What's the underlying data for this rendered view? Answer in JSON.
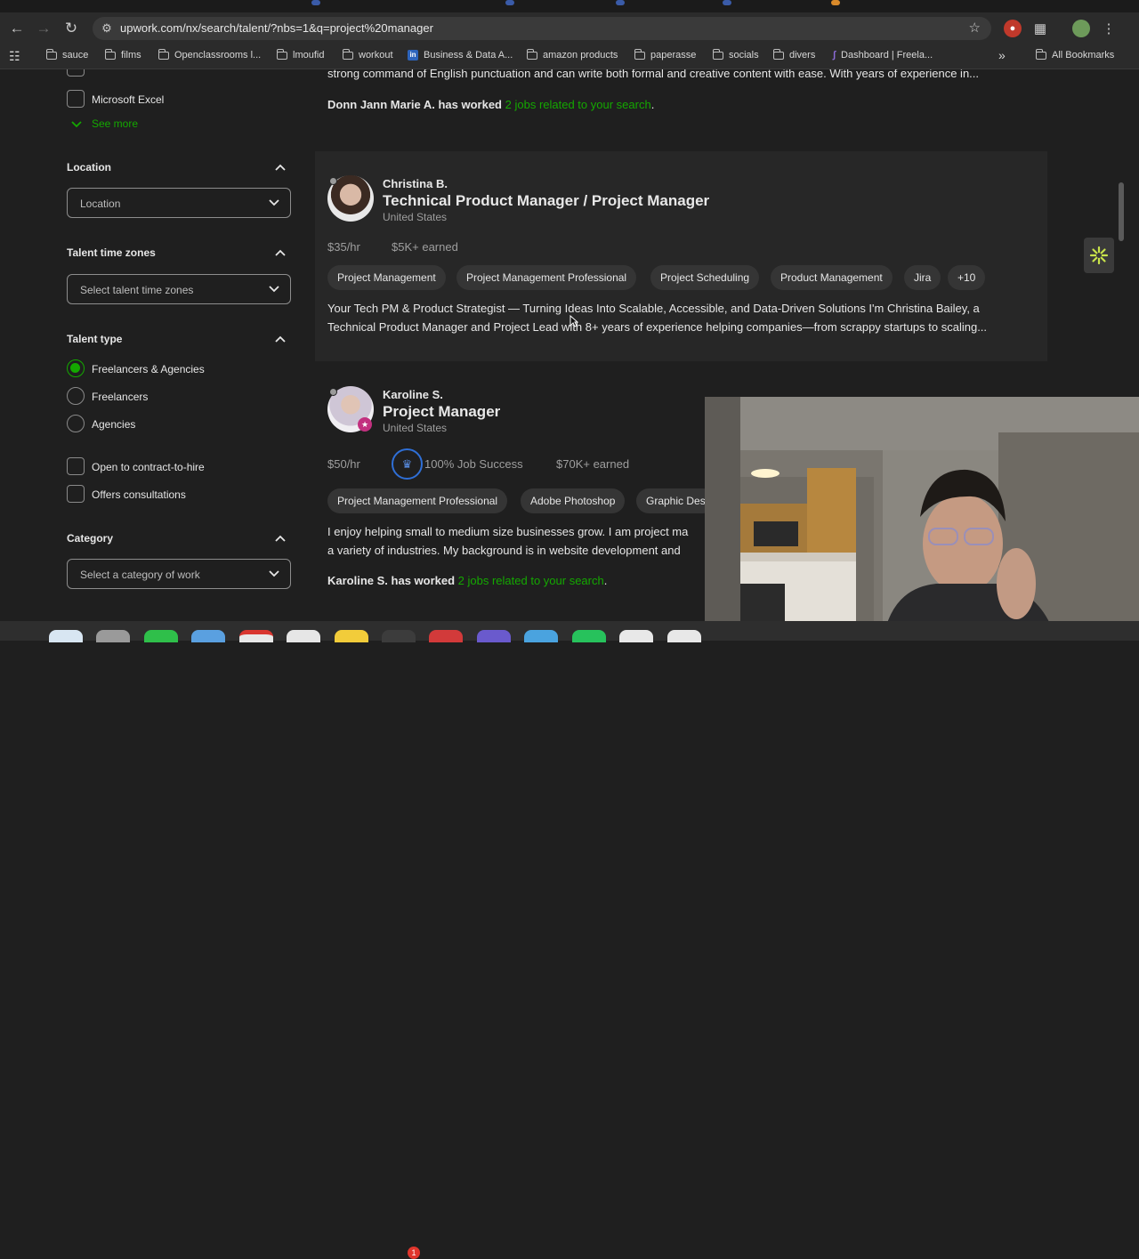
{
  "browser": {
    "url": "upwork.com/nx/search/talent/?nbs=1&q=project%20manager",
    "bookmarks": [
      "sauce",
      "films",
      "Openclassrooms l...",
      "lmoufid",
      "workout",
      "Business & Data A...",
      "amazon products",
      "paperasse",
      "socials",
      "divers",
      "Dashboard | Freela..."
    ],
    "all_bookmarks_label": "All Bookmarks"
  },
  "sidebar": {
    "skills_option": "Microsoft Excel",
    "see_more": "See more",
    "location": {
      "title": "Location",
      "placeholder": "Location"
    },
    "timezones": {
      "title": "Talent time zones",
      "placeholder": "Select talent time zones"
    },
    "talent_type": {
      "title": "Talent type",
      "options": [
        "Freelancers & Agencies",
        "Freelancers",
        "Agencies"
      ],
      "selected": "Freelancers & Agencies"
    },
    "extra_options": [
      "Open to contract-to-hire",
      "Offers consultations"
    ],
    "category": {
      "title": "Category",
      "placeholder": "Select a category of work"
    }
  },
  "results": {
    "prev_card": {
      "snippet": "strong command of English punctuation and can write both formal and creative content with ease. With years of experience in...",
      "worked_prefix": "Donn Jann Marie A. has worked",
      "worked_link": "2 jobs related to your search",
      "worked_suffix": "."
    },
    "card1": {
      "name": "Christina B.",
      "title": "Technical Product Manager / Project Manager",
      "location": "United States",
      "rate": "$35/hr",
      "earned": "$5K+ earned",
      "skills": [
        "Project Management",
        "Project Management Professional",
        "Project Scheduling",
        "Product Management",
        "Jira",
        "+10"
      ],
      "desc_line1": "Your Tech PM & Product Strategist — Turning Ideas Into Scalable, Accessible, and Data-Driven Solutions I'm Christina Bailey, a",
      "desc_line2": "Technical Product Manager and Project Lead with 8+ years of experience helping companies—from scrappy startups to scaling..."
    },
    "card2": {
      "name": "Karoline S.",
      "title": "Project Manager",
      "location": "United States",
      "rate": "$50/hr",
      "job_success": "100% Job Success",
      "earned": "$70K+ earned",
      "skills": [
        "Project Management Professional",
        "Adobe Photoshop",
        "Graphic Des"
      ],
      "desc_line1": "I enjoy helping small to medium size businesses grow. I am project ma",
      "desc_line2": "a variety of industries. My background is in website development and",
      "worked_prefix": "Karoline S. has worked",
      "worked_link": "2 jobs related to your search",
      "worked_suffix": "."
    }
  },
  "colors": {
    "accent": "#14a800",
    "background": "#1f1f1f",
    "card": "#272727"
  }
}
